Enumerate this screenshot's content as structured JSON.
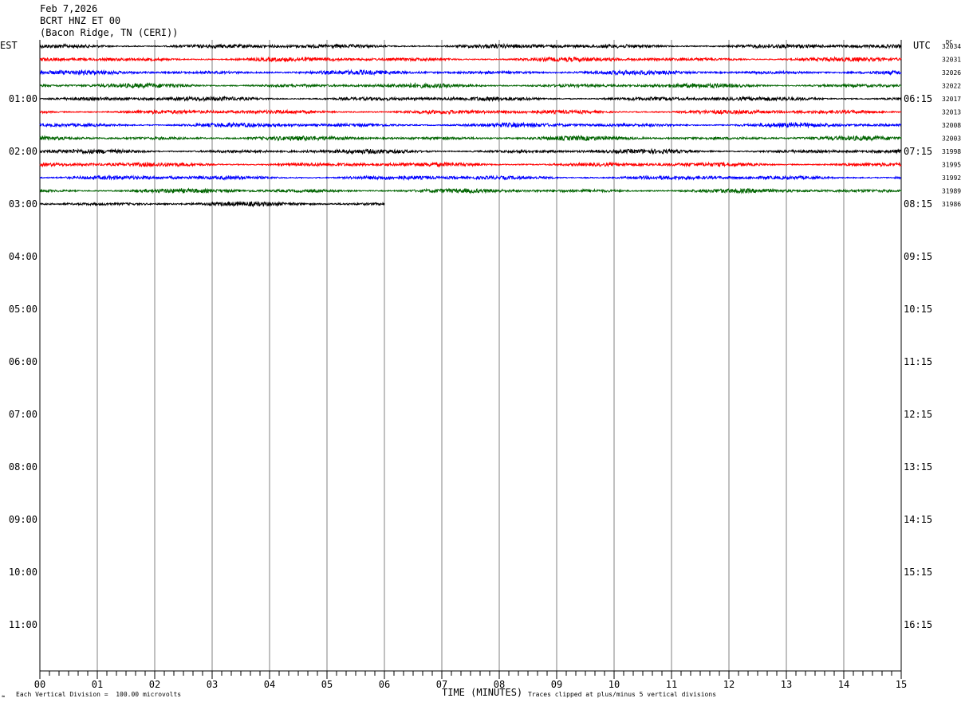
{
  "header": {
    "date": "Feb 7,2026",
    "station": "BCRT HNZ ET 00",
    "location": "(Bacon Ridge, TN (CERI))"
  },
  "left_tz": "EST",
  "right_tz": "UTC",
  "dc_label": "DC",
  "footer": {
    "scale": "Each Vertical Division =  100.00 microvolts",
    "clip": "Traces clipped at plus/minus 5 vertical divisions"
  },
  "chart_data": {
    "type": "line",
    "xlabel": "TIME (MINUTES)",
    "xlim": [
      0,
      15
    ],
    "x_ticks": [
      "00",
      "01",
      "02",
      "03",
      "04",
      "05",
      "06",
      "07",
      "08",
      "09",
      "10",
      "11",
      "12",
      "13",
      "14",
      "15"
    ],
    "left_hour_labels": [
      "01:00",
      "02:00",
      "03:00",
      "04:00",
      "05:00",
      "06:00",
      "07:00",
      "08:00",
      "09:00",
      "10:00",
      "11:00"
    ],
    "right_hour_labels": [
      "06:15",
      "07:15",
      "08:15",
      "09:15",
      "10:15",
      "11:15",
      "12:15",
      "13:15",
      "14:15",
      "15:15",
      "16:15"
    ],
    "rows_per_hour": 4,
    "total_rows": 48,
    "trace_colors": [
      "#000000",
      "#ff0000",
      "#0000ff",
      "#006400"
    ],
    "traces": [
      {
        "row": 0,
        "dc": "32034",
        "end_minute": 15
      },
      {
        "row": 1,
        "dc": "32031",
        "end_minute": 15
      },
      {
        "row": 2,
        "dc": "32026",
        "end_minute": 15
      },
      {
        "row": 3,
        "dc": "32022",
        "end_minute": 15
      },
      {
        "row": 4,
        "dc": "32017",
        "end_minute": 15
      },
      {
        "row": 5,
        "dc": "32013",
        "end_minute": 15
      },
      {
        "row": 6,
        "dc": "32008",
        "end_minute": 15
      },
      {
        "row": 7,
        "dc": "32003",
        "end_minute": 15
      },
      {
        "row": 8,
        "dc": "31998",
        "end_minute": 15
      },
      {
        "row": 9,
        "dc": "31995",
        "end_minute": 15
      },
      {
        "row": 10,
        "dc": "31992",
        "end_minute": 15
      },
      {
        "row": 11,
        "dc": "31989",
        "end_minute": 15
      },
      {
        "row": 12,
        "dc": "31986",
        "end_minute": 6
      }
    ]
  }
}
